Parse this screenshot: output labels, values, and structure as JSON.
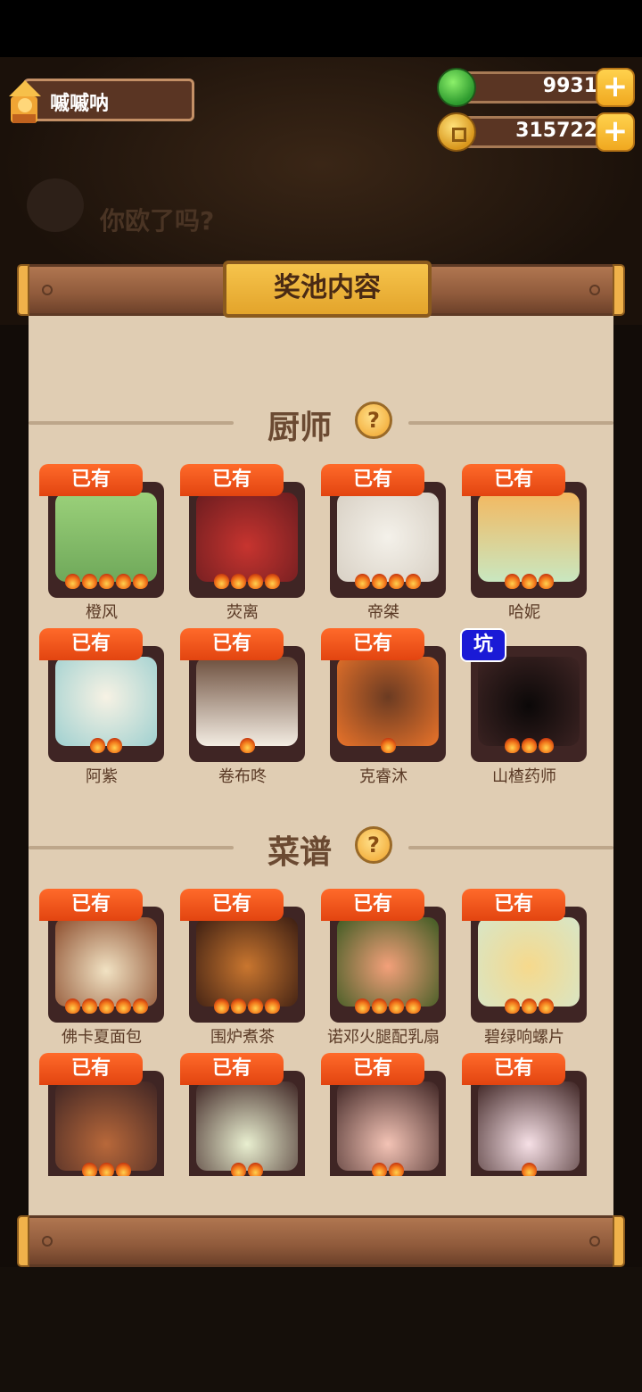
{
  "player": {
    "name": "嘁嘁呐"
  },
  "currency": {
    "gems": {
      "value": "9931",
      "plus": "+"
    },
    "coins": {
      "value": "315722",
      "plus": "+"
    }
  },
  "background": {
    "banner_text": "你欧了吗?"
  },
  "panel": {
    "title": "奖池内容"
  },
  "sections": {
    "chefs": {
      "label": "厨师",
      "help": "?"
    },
    "recipes": {
      "label": "菜谱",
      "help": "?"
    }
  },
  "chefs": [
    {
      "name": "橙风",
      "badge": "已有",
      "stars": 5
    },
    {
      "name": "荧离",
      "badge": "已有",
      "stars": 4
    },
    {
      "name": "帝桀",
      "badge": "已有",
      "stars": 4
    },
    {
      "name": "哈妮",
      "badge": "已有",
      "stars": 3
    },
    {
      "name": "阿紫",
      "badge": "已有",
      "stars": 2
    },
    {
      "name": "卷布咚",
      "badge": "已有",
      "stars": 1
    },
    {
      "name": "克睿沐",
      "badge": "已有",
      "stars": 1
    },
    {
      "name": "山楂药师",
      "badge": "坑",
      "stars": 3
    }
  ],
  "recipes": [
    {
      "name": "佛卡夏面包",
      "badge": "已有",
      "stars": 5
    },
    {
      "name": "围炉煮茶",
      "badge": "已有",
      "stars": 4
    },
    {
      "name": "诺邓火腿配乳扇",
      "badge": "已有",
      "stars": 4
    },
    {
      "name": "碧绿响螺片",
      "badge": "已有",
      "stars": 3
    },
    {
      "name": "",
      "badge": "已有",
      "stars": 3
    },
    {
      "name": "",
      "badge": "已有",
      "stars": 2
    },
    {
      "name": "",
      "badge": "已有",
      "stars": 2
    },
    {
      "name": "",
      "badge": "已有",
      "stars": 1
    }
  ],
  "colors": {
    "owned_badge": "#e24410",
    "missing_badge": "#1a1ad6",
    "panel_bg": "#e0cdb3",
    "plaque": "#f2b83c"
  }
}
